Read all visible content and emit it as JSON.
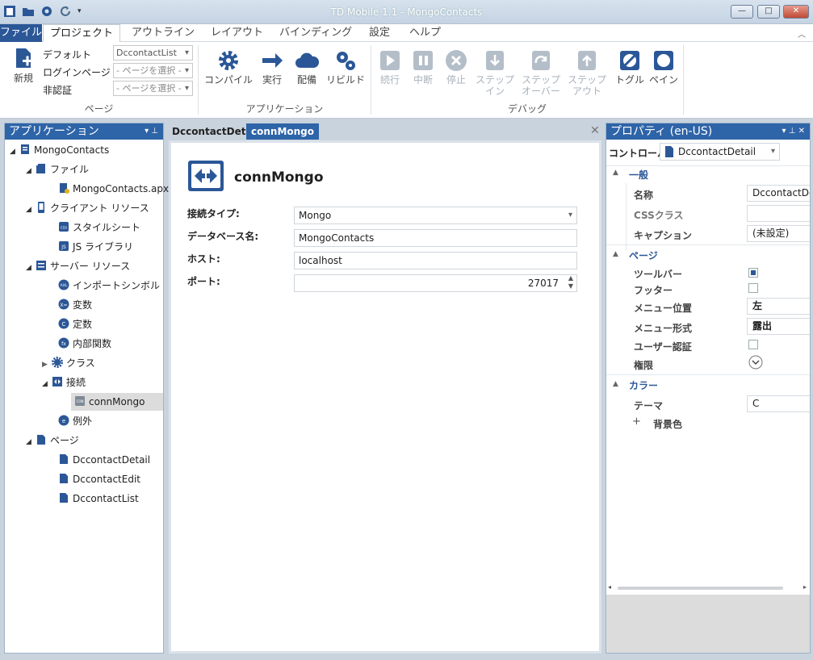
{
  "window": {
    "title": "TD Mobile 1.1 - MongoContacts"
  },
  "menu": {
    "file": "ファイル",
    "project": "プロジェクト",
    "outline": "アウトライン",
    "layout": "レイアウト",
    "binding": "バインディング",
    "settings": "設定",
    "help": "ヘルプ"
  },
  "ribbon": {
    "page_group": {
      "new_label": "新規",
      "default_label": "デフォルト",
      "login_label": "ログインページ",
      "unauth_label": "非認証",
      "default_value": "DccontactList",
      "login_value": "- ページを選択 -",
      "unauth_value": "- ページを選択 -",
      "title": "ページ"
    },
    "app_group": {
      "compile": "コンパイル",
      "run": "実行",
      "deploy": "配備",
      "rebuild": "リビルド",
      "title": "アプリケーション"
    },
    "debug_group": {
      "continue": "続行",
      "pause": "中断",
      "stop": "停止",
      "step_in_1": "ステップ",
      "step_in_2": "イン",
      "step_over_1": "ステップ",
      "step_over_2": "オーバー",
      "step_out_1": "ステップ",
      "step_out_2": "アウト",
      "toggle": "トグル",
      "pane": "ペイン",
      "title": "デバッグ"
    }
  },
  "app_pane": {
    "title": "アプリケーション",
    "tree": {
      "root": "MongoContacts",
      "files": "ファイル",
      "apx": "MongoContacts.apx",
      "client": "クライアント リソース",
      "stylesheet": "スタイルシート",
      "jslib": "JS ライブラリ",
      "server": "サーバー リソース",
      "import": "インポートシンボル",
      "vars": "変数",
      "consts": "定数",
      "funcs": "内部関数",
      "classes": "クラス",
      "connections": "接続",
      "connmongo": "connMongo",
      "exceptions": "例外",
      "pages": "ページ",
      "page1": "DccontactDetail",
      "page2": "DccontactEdit",
      "page3": "DccontactList"
    }
  },
  "doc": {
    "tab1": "DccontactDetail",
    "tab2": "connMongo",
    "heading": "connMongo",
    "conn_type_label": "接続タイプ:",
    "conn_type_value": "Mongo",
    "db_label": "データベース名:",
    "db_value": "MongoContacts",
    "host_label": "ホスト:",
    "host_value": "localhost",
    "port_label": "ポート:",
    "port_value": "27017"
  },
  "props": {
    "title": "プロパティ (en-US)",
    "control_label": "コントロール:",
    "control_value": "DccontactDetail",
    "cat_general": "一般",
    "name_label": "名称",
    "name_value": "DccontactDe",
    "css_label": "CSSクラス",
    "css_value": "",
    "caption_label": "キャプション",
    "caption_value": "(未設定)",
    "cat_page": "ページ",
    "toolbar_label": "ツールバー",
    "footer_label": "フッター",
    "menu_pos_label": "メニュー位置",
    "menu_pos_value": "左",
    "menu_style_label": "メニュー形式",
    "menu_style_value": "露出",
    "user_auth_label": "ユーザー認証",
    "perm_label": "権限",
    "cat_color": "カラー",
    "theme_label": "テーマ",
    "theme_value": "C",
    "bg_label": "背景色"
  },
  "colors": {
    "accent": "#2b5797",
    "header": "#2e64a8",
    "ribbon_icon": "#2b5797",
    "disabled": "#a8b2bc"
  }
}
